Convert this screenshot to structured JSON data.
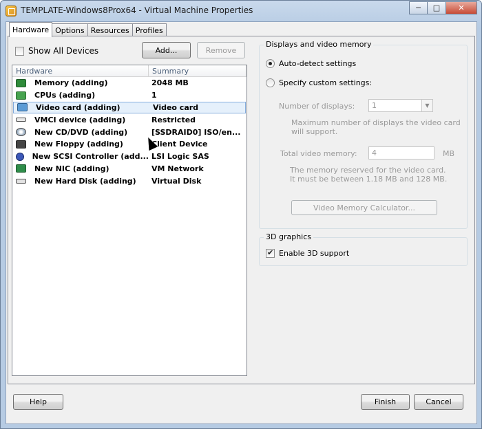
{
  "window": {
    "title": "TEMPLATE-Windows8Prox64 - Virtual Machine Properties",
    "minimize_icon": "minimize-icon",
    "maximize_icon": "maximize-icon",
    "close_icon": "close-icon"
  },
  "tabs": [
    {
      "label": "Hardware",
      "active": true
    },
    {
      "label": "Options",
      "active": false
    },
    {
      "label": "Resources",
      "active": false
    },
    {
      "label": "Profiles",
      "active": false
    }
  ],
  "hardware": {
    "show_all_devices_label": "Show All Devices",
    "show_all_devices_checked": false,
    "add_button": "Add...",
    "remove_button": "Remove",
    "columns": [
      "Hardware",
      "Summary"
    ],
    "rows": [
      {
        "icon": "memory-icon",
        "name": "Memory (adding)",
        "summary": "2048 MB"
      },
      {
        "icon": "cpu-icon",
        "name": "CPUs (adding)",
        "summary": "1"
      },
      {
        "icon": "video-card-icon",
        "name": "Video card  (adding)",
        "summary": "Video card",
        "selected": true
      },
      {
        "icon": "vmci-device-icon",
        "name": "VMCI device (adding)",
        "summary": "Restricted"
      },
      {
        "icon": "cd-dvd-icon",
        "name": "New CD/DVD (adding)",
        "summary": "[SSDRAID0] ISO/en..."
      },
      {
        "icon": "floppy-icon",
        "name": "New Floppy (adding)",
        "summary": "Client Device"
      },
      {
        "icon": "scsi-controller-icon",
        "name": "New SCSI Controller (add...",
        "summary": "LSI Logic SAS"
      },
      {
        "icon": "nic-icon",
        "name": "New NIC (adding)",
        "summary": "VM Network"
      },
      {
        "icon": "hard-disk-icon",
        "name": "New Hard Disk (adding)",
        "summary": "Virtual Disk"
      }
    ]
  },
  "video": {
    "group_title": "Displays and video memory",
    "auto_detect_label": "Auto-detect settings",
    "custom_label": "Specify custom settings:",
    "selected_option": "auto-detect",
    "num_displays_label": "Number of displays:",
    "num_displays_value": "1",
    "num_displays_note_1": "Maximum number of displays the video card",
    "num_displays_note_2": "will support.",
    "total_memory_label": "Total video memory:",
    "total_memory_value": "4",
    "total_memory_unit": "MB",
    "memory_note_1": "The memory reserved for the video card.",
    "memory_note_2": "It must be between 1.18 MB and 128 MB.",
    "calculator_button": "Video Memory Calculator..."
  },
  "graphics3d": {
    "group_title": "3D graphics",
    "enable_label": "Enable 3D support",
    "enable_checked": true
  },
  "footer": {
    "help_button": "Help",
    "finish_button": "Finish",
    "cancel_button": "Cancel"
  }
}
